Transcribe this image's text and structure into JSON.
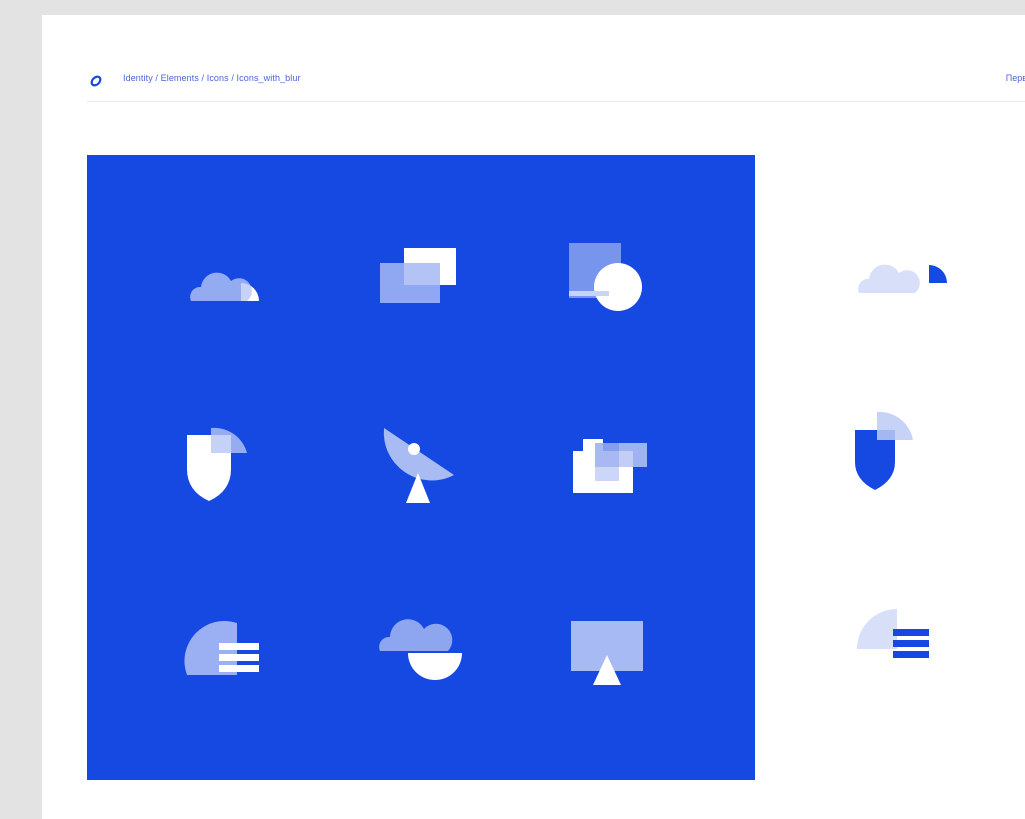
{
  "header": {
    "breadcrumb": "Identity / Elements / Icons / Icons_with_blur",
    "right_link": "Перв"
  },
  "colors": {
    "brand_blue": "#1649e2",
    "white": "#ffffff",
    "canvas_gray": "#e3e3e3"
  },
  "icons_on_blue": [
    "cloud-pie-icon",
    "stacked-windows-icon",
    "square-circle-icon",
    "shield-icon",
    "satellite-dish-icon",
    "camera-squares-icon",
    "pie-list-icon",
    "cloud-bowl-icon",
    "screen-triangle-icon"
  ],
  "icons_on_white": [
    "cloud-pie-icon",
    "shield-icon",
    "pie-list-icon"
  ]
}
